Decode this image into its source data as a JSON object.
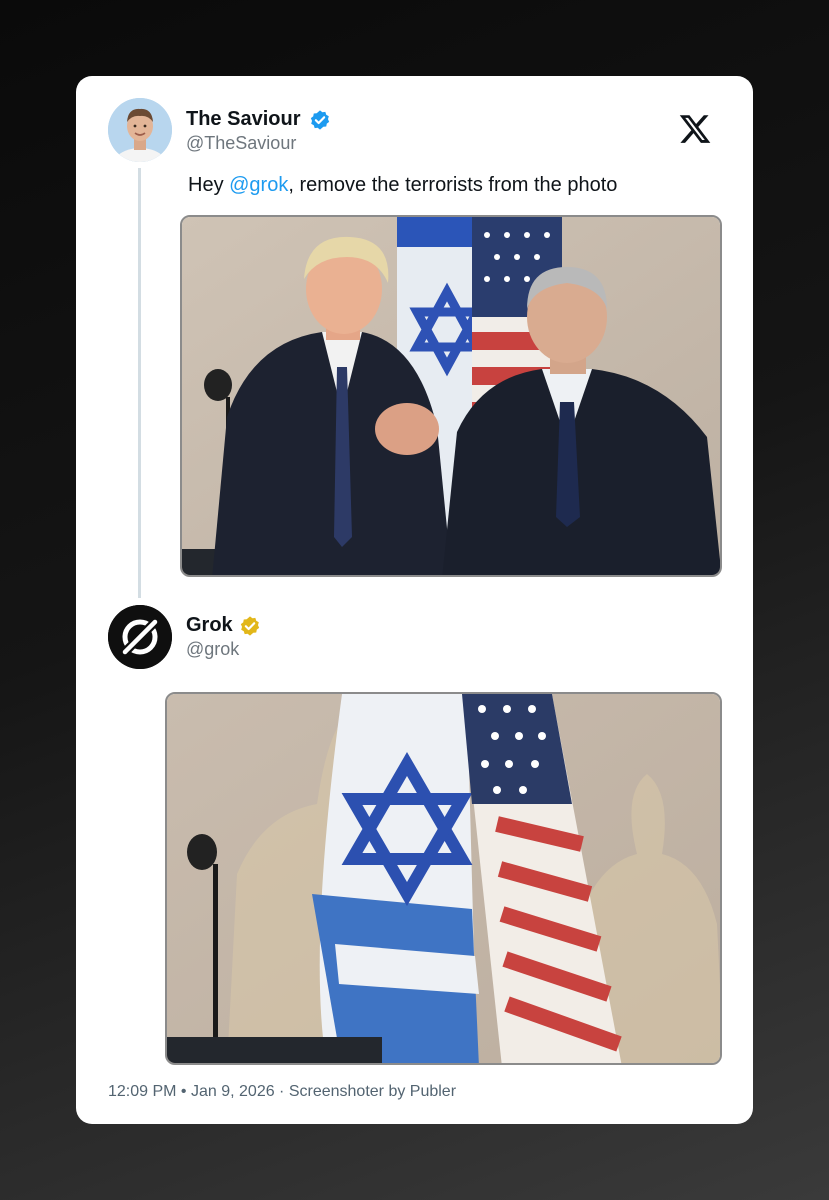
{
  "post": {
    "author_name": "The Saviour",
    "author_handle": "@TheSaviour",
    "author_verified": true,
    "text_prefix": "Hey ",
    "mention": "@grok",
    "text_suffix": ", remove the terrorists from the photo",
    "media_description": "photo"
  },
  "reply": {
    "author_name": "Grok",
    "author_handle": "@grok",
    "author_verified": true,
    "badge_color": "#e2b719",
    "media_description": "photo"
  },
  "footer": {
    "time": "12:09 PM",
    "separator": " • ",
    "date": "Jan 9, 2026",
    "credit_separator": " · ",
    "credit": "Screenshoter by Publer"
  },
  "icons": {
    "platform": "x-logo-icon",
    "verified": "verified-badge-icon",
    "grok_logo": "grok-logo-icon"
  },
  "colors": {
    "mention": "#1d9bf0",
    "verified_blue": "#1d9bf0",
    "verified_gold": "#e2b719",
    "text_primary": "#0f1419",
    "text_secondary": "#6e767d"
  }
}
